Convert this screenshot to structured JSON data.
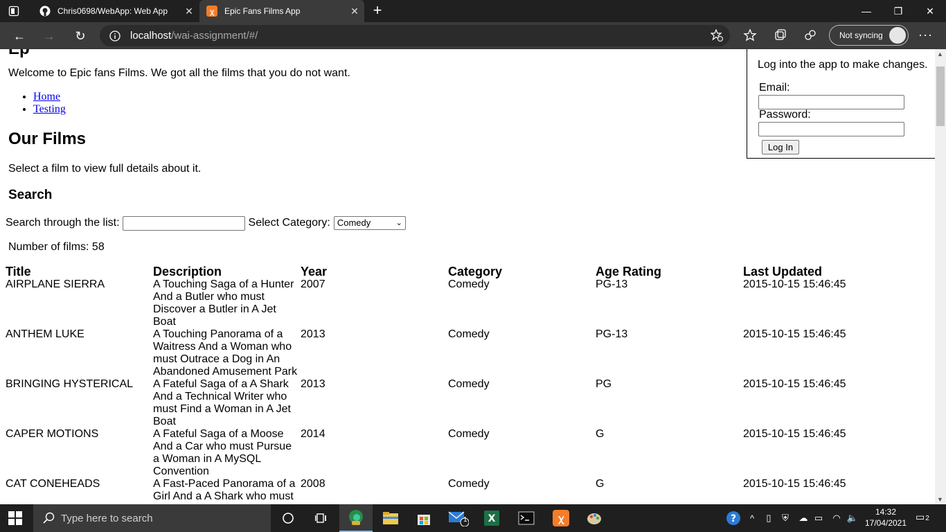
{
  "browser": {
    "tabs": [
      {
        "title": "Chris0698/WebApp: Web App",
        "active": false
      },
      {
        "title": "Epic Fans Films App",
        "active": true
      }
    ],
    "url_host": "localhost",
    "url_path": "/wai-assignment/#/",
    "sync_label": "Not syncing"
  },
  "page": {
    "welcome": "Welcome to Epic fans Films. We got all the films that you do not want.",
    "nav": [
      "Home",
      "Testing"
    ],
    "films_heading": "Our Films",
    "select_text": "Select a film to view full details about it.",
    "search_heading": "Search",
    "search_label": "Search through the list:",
    "search_value": "",
    "category_label": "Select Category:",
    "category_selected": "Comedy",
    "count_text": "Number of films: 58",
    "table": {
      "headers": [
        "Title",
        "Description",
        "Year",
        "Category",
        "Age Rating",
        "Last Updated"
      ],
      "rows": [
        [
          "AIRPLANE SIERRA",
          "A Touching Saga of a Hunter And a Butler who must Discover a Butler in A Jet Boat",
          "2007",
          "Comedy",
          "PG-13",
          "2015-10-15 15:46:45"
        ],
        [
          "ANTHEM LUKE",
          "A Touching Panorama of a Waitress And a Woman who must Outrace a Dog in An Abandoned Amusement Park",
          "2013",
          "Comedy",
          "PG-13",
          "2015-10-15 15:46:45"
        ],
        [
          "BRINGING HYSTERICAL",
          "A Fateful Saga of a A Shark And a Technical Writer who must Find a Woman in A Jet Boat",
          "2013",
          "Comedy",
          "PG",
          "2015-10-15 15:46:45"
        ],
        [
          "CAPER MOTIONS",
          "A Fateful Saga of a Moose And a Car who must Pursue a Woman in A MySQL Convention",
          "2014",
          "Comedy",
          "G",
          "2015-10-15 15:46:45"
        ],
        [
          "CAT CONEHEADS",
          "A Fast-Paced Panorama of a Girl And a A Shark who must",
          "2008",
          "Comedy",
          "G",
          "2015-10-15 15:46:45"
        ]
      ]
    },
    "login": {
      "message": "Log into the app to make changes.",
      "email_label": "Email:",
      "password_label": "Password:",
      "button": "Log In"
    }
  },
  "taskbar": {
    "search_placeholder": "Type here to search",
    "time": "14:32",
    "date": "17/04/2021",
    "notification_count": "2",
    "mail_badge": "1"
  }
}
